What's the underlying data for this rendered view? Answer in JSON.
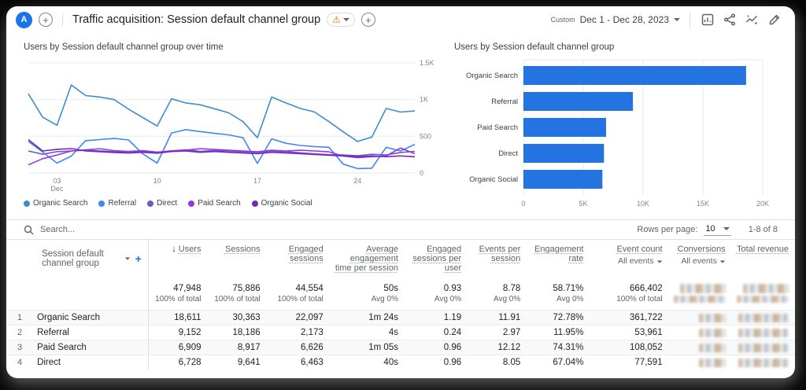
{
  "header": {
    "logo_letter": "A",
    "title": "Traffic acquisition: Session default channel group",
    "date_label": "Custom",
    "date_range": "Dec 1 - Dec 28, 2023",
    "icons": [
      "customize-report",
      "share",
      "insights",
      "edit"
    ]
  },
  "chart_data": [
    {
      "type": "line",
      "title": "Users by Session default channel group over time",
      "ylabel": "Users",
      "ylim": [
        0,
        1500
      ],
      "yticks": [
        {
          "v": 0,
          "label": "0"
        },
        {
          "v": 500,
          "label": "500"
        },
        {
          "v": 1000,
          "label": "1K"
        },
        {
          "v": 1500,
          "label": "1.5K"
        }
      ],
      "xticks": [
        {
          "day": 3,
          "label": "03",
          "sublabel": "Dec"
        },
        {
          "day": 10,
          "label": "10"
        },
        {
          "day": 17,
          "label": "17"
        },
        {
          "day": 24,
          "label": "24"
        }
      ],
      "series": [
        {
          "name": "Organic Search",
          "color": "#3D8EC9",
          "values": [
            1080,
            760,
            650,
            1200,
            1055,
            1035,
            1000,
            870,
            755,
            640,
            1010,
            955,
            930,
            875,
            820,
            700,
            480,
            1035,
            955,
            880,
            830,
            700,
            560,
            430,
            490,
            880,
            830,
            845
          ]
        },
        {
          "name": "Referral",
          "color": "#4285F4",
          "values": [
            430,
            285,
            135,
            230,
            440,
            455,
            470,
            450,
            260,
            135,
            545,
            590,
            565,
            540,
            520,
            480,
            130,
            465,
            405,
            375,
            360,
            350,
            120,
            60,
            65,
            350,
            300,
            390
          ]
        },
        {
          "name": "Direct",
          "color": "#685BC7",
          "values": [
            300,
            255,
            290,
            300,
            315,
            330,
            305,
            295,
            305,
            285,
            300,
            315,
            295,
            305,
            300,
            290,
            280,
            300,
            290,
            275,
            260,
            250,
            245,
            235,
            255,
            245,
            280,
            295
          ]
        },
        {
          "name": "Paid Search",
          "color": "#9334E6",
          "values": [
            110,
            195,
            245,
            300,
            310,
            300,
            290,
            282,
            292,
            280,
            302,
            312,
            330,
            320,
            310,
            300,
            288,
            310,
            300,
            310,
            300,
            288,
            230,
            210,
            222,
            232,
            340,
            262
          ]
        },
        {
          "name": "Organic Social",
          "color": "#7627BB",
          "values": [
            455,
            300,
            322,
            332,
            300,
            290,
            280,
            272,
            282,
            270,
            292,
            300,
            282,
            292,
            282,
            272,
            262,
            282,
            272,
            262,
            252,
            242,
            232,
            222,
            232,
            222,
            232,
            222
          ]
        }
      ]
    },
    {
      "type": "bar",
      "title": "Users by Session default channel group",
      "categories": [
        "Organic Search",
        "Referral",
        "Paid Search",
        "Direct",
        "Organic Social"
      ],
      "values": [
        18611,
        9152,
        6909,
        6728,
        6600
      ],
      "xlim": [
        0,
        20000
      ],
      "xticks": [
        {
          "v": 0,
          "label": "0"
        },
        {
          "v": 5000,
          "label": "5K"
        },
        {
          "v": 10000,
          "label": "10K"
        },
        {
          "v": 15000,
          "label": "15K"
        },
        {
          "v": 20000,
          "label": "20K"
        }
      ],
      "bar_color": "#2374E1"
    }
  ],
  "table": {
    "search_placeholder": "Search...",
    "rows_per_page_label": "Rows per page:",
    "rows_per_page_value": "10",
    "pagination": "1-8 of 8",
    "dimension_header": "Session default channel group",
    "columns": [
      {
        "label": "Users",
        "sorted": true,
        "width": "7.5%"
      },
      {
        "label": "Sessions",
        "width": "7.5%"
      },
      {
        "label": "Engaged sessions",
        "width": "8%"
      },
      {
        "label": "Average engagement time per session",
        "width": "9.5%"
      },
      {
        "label": "Engaged sessions per user",
        "width": "8%"
      },
      {
        "label": "Events per session",
        "width": "7.5%"
      },
      {
        "label": "Engagement rate",
        "width": "8%"
      },
      {
        "label": "Event count",
        "sub": "All events",
        "width": "10%"
      },
      {
        "label": "Conversions",
        "sub": "All events",
        "width": "8%"
      },
      {
        "label": "Total revenue",
        "width": "8%"
      }
    ],
    "totals": [
      {
        "value": "47,948",
        "sub": "100% of total"
      },
      {
        "value": "75,886",
        "sub": "100% of total"
      },
      {
        "value": "44,554",
        "sub": "100% of total"
      },
      {
        "value": "50s",
        "sub": "Avg 0%"
      },
      {
        "value": "0.93",
        "sub": "Avg 0%"
      },
      {
        "value": "8.78",
        "sub": "Avg 0%"
      },
      {
        "value": "58.71%",
        "sub": "Avg 0%"
      },
      {
        "value": "666,402",
        "sub": "100% of total"
      },
      {
        "value": "[redacted]",
        "sub": "[redacted]"
      },
      {
        "value": "[redacted]",
        "sub": "[redacted]"
      }
    ],
    "rows": [
      {
        "num": "1",
        "name": "Organic Search",
        "values": [
          "18,611",
          "30,363",
          "22,097",
          "1m 24s",
          "1.19",
          "11.91",
          "72.78%",
          "361,722",
          "[redacted]",
          "[redacted]"
        ]
      },
      {
        "num": "2",
        "name": "Referral",
        "values": [
          "9,152",
          "18,186",
          "2,173",
          "4s",
          "0.24",
          "2.97",
          "11.95%",
          "53,961",
          "[redacted]",
          "[redacted]"
        ]
      },
      {
        "num": "3",
        "name": "Paid Search",
        "values": [
          "6,909",
          "8,917",
          "6,626",
          "1m 05s",
          "0.96",
          "12.12",
          "74.31%",
          "108,052",
          "[redacted]",
          "[redacted]"
        ]
      },
      {
        "num": "4",
        "name": "Direct",
        "values": [
          "6,728",
          "9,641",
          "6,463",
          "40s",
          "0.96",
          "8.05",
          "67.04%",
          "77,591",
          "[redacted]",
          "[redacted]"
        ]
      }
    ]
  },
  "colors": {
    "accent_blue": "#1a73e8",
    "warning_orange": "#e8710a",
    "grid_gray": "#e8eaed",
    "axis_text": "#80868b"
  }
}
